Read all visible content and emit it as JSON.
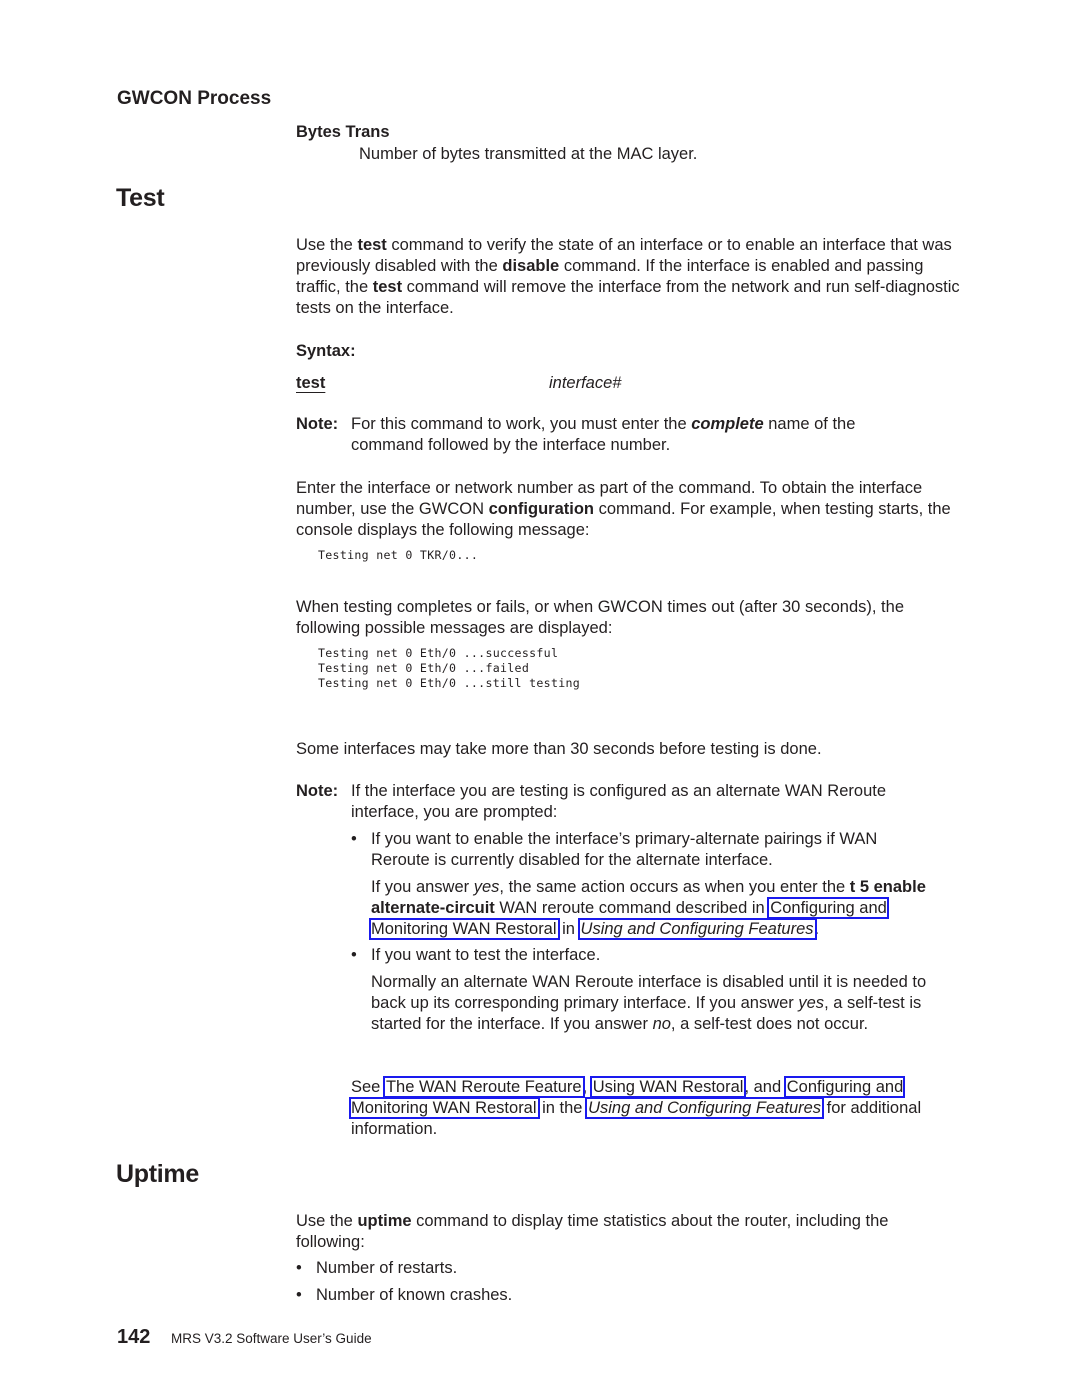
{
  "running_head": "GWCON Process",
  "bytes_trans": {
    "term": "Bytes Trans",
    "definition": "Number of bytes transmitted at the MAC layer."
  },
  "test_section": {
    "title": "Test",
    "intro": {
      "p1": "Use the ",
      "b1": "test",
      "p2": " command to verify the state of an interface or to enable an interface that was previously disabled with the ",
      "b2": "disable",
      "p3": " command. If the interface is enabled and passing traffic, the ",
      "b3": "test",
      "p4": " command will remove the interface from the network and run self-diagnostic tests on the interface."
    },
    "syntax_label": "Syntax:",
    "syntax_command": "test",
    "syntax_param": "interface#",
    "note1": {
      "label": "Note:",
      "p1": "For this command to work, you must enter the ",
      "em": "complete",
      "p2": " name of the command followed by the interface number."
    },
    "enter_para": {
      "p1": "Enter the interface or network number as part of the command. To obtain the interface number, use the GWCON ",
      "b1": "configuration",
      "p2": " command. For example, when testing starts, the console displays the following message:"
    },
    "console_start": "Testing net 0 TKR/0...",
    "when_para": "When testing completes or fails, or when GWCON times out (after 30 seconds), the following possible messages are displayed:",
    "console_results": [
      "Testing net 0 Eth/0 ...successful",
      "Testing net 0 Eth/0 ...failed",
      "Testing net 0 Eth/0 ...still testing"
    ],
    "some_para": "Some interfaces may take more than 30 seconds before testing is done.",
    "note2": {
      "label": "Note:",
      "text": "If the interface you are testing is configured as an alternate WAN Reroute interface, you are prompted:",
      "bullet_char": "•",
      "bullets": [
        {
          "text": "If you want to enable the interface’s primary-alternate pairings if WAN Reroute is currently disabled for the alternate interface.",
          "detail": {
            "p1": "If you answer ",
            "i1": "yes",
            "p2": ", the same action occurs as when you enter the ",
            "b1": "t 5 enable alternate-circuit",
            "p3": " WAN reroute command described in ",
            "link1": "Configuring and Monitoring WAN Restoral",
            "p4": " in ",
            "link2": "Using and Configuring Features",
            "p5": "."
          }
        },
        {
          "text": "If you want to test the interface.",
          "detail": {
            "p1": "Normally an alternate WAN Reroute interface is disabled until it is needed to back up its corresponding primary interface. If you answer ",
            "i1": "yes",
            "p2": ", a self-test is started for the interface. If you answer ",
            "i2": "no",
            "p3": ", a self-test does not occur."
          }
        }
      ],
      "see_also": {
        "p1": "See ",
        "link1": "The WAN Reroute Feature",
        "p2": ", ",
        "link2": "Using WAN Restoral",
        "p3": ", and ",
        "link3": "Configuring and Monitoring WAN Restoral",
        "p4": " in the ",
        "link4": "Using and Configuring Features",
        "p5": " for additional information."
      }
    }
  },
  "uptime_section": {
    "title": "Uptime",
    "intro": {
      "p1": "Use the ",
      "b1": "uptime",
      "p2": " command to display time statistics about the router, including the following:"
    },
    "bullet_char": "•",
    "bullets": [
      "Number of restarts.",
      "Number of known crashes."
    ]
  },
  "footer": {
    "page_number": "142",
    "book_title": "MRS V3.2 Software User’s Guide"
  },
  "colors": {
    "text": "#231f20",
    "link_border": "#1a1aee"
  }
}
